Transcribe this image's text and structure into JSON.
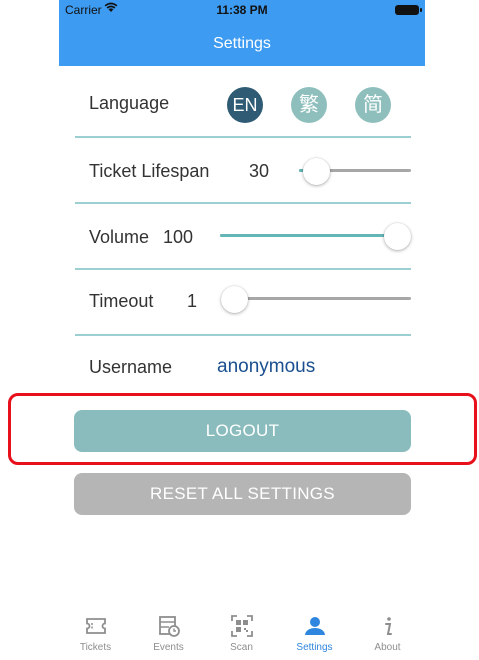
{
  "status_bar": {
    "carrier": "Carrier",
    "time": "11:38 PM"
  },
  "nav": {
    "title": "Settings"
  },
  "settings": {
    "language": {
      "label": "Language",
      "options": [
        "EN",
        "繁",
        "简"
      ],
      "selected": "EN"
    },
    "ticket_lifespan": {
      "label": "Ticket Lifespan",
      "value": "30",
      "fraction": 0.05
    },
    "volume": {
      "label": "Volume",
      "value": "100",
      "fraction": 1.0
    },
    "timeout": {
      "label": "Timeout",
      "value": "1",
      "fraction": 0.0
    },
    "username": {
      "label": "Username",
      "value": "anonymous"
    }
  },
  "buttons": {
    "logout": "LOGOUT",
    "reset": "RESET ALL SETTINGS"
  },
  "tabs": [
    {
      "label": "Tickets",
      "icon": "ticket-icon"
    },
    {
      "label": "Events",
      "icon": "calendar-icon"
    },
    {
      "label": "Scan",
      "icon": "qr-scan-icon"
    },
    {
      "label": "Settings",
      "icon": "person-icon",
      "active": true
    },
    {
      "label": "About",
      "icon": "info-icon"
    }
  ],
  "colors": {
    "nav_bar": "#3d9bf2",
    "accent_dark": "#2f5b75",
    "accent_teal": "#8ebfbd",
    "highlight": "#e8101a",
    "tab_active": "#2f86df"
  }
}
